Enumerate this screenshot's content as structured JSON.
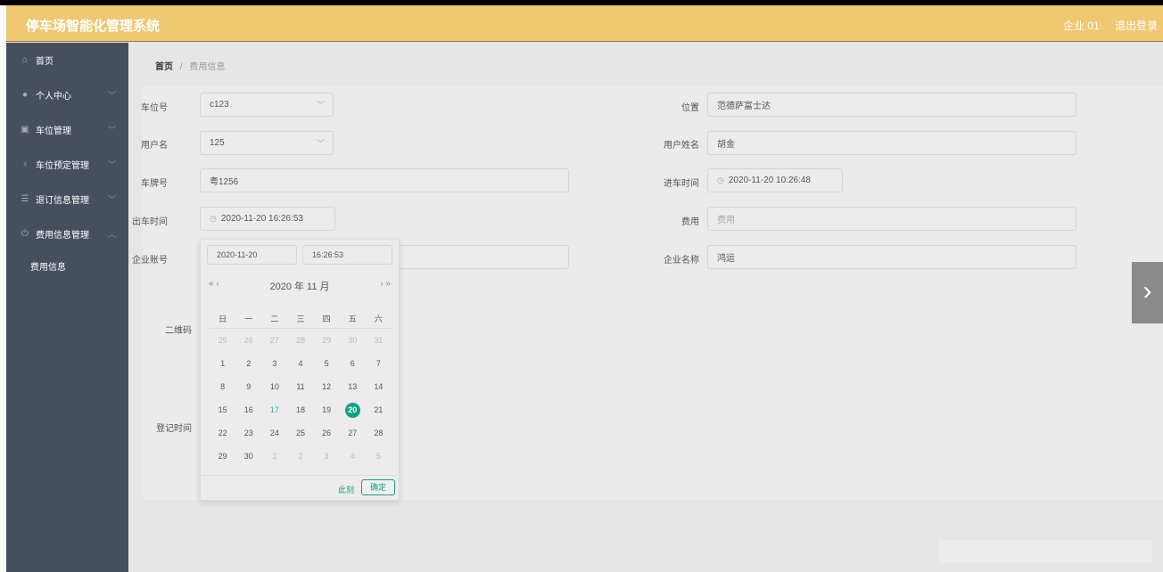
{
  "header": {
    "title": "停车场智能化管理系统",
    "user": "企业 01",
    "logout": "退出登录"
  },
  "sidebar": {
    "items": [
      {
        "label": "首页"
      },
      {
        "label": "个人中心"
      },
      {
        "label": "车位管理"
      },
      {
        "label": "车位预定管理"
      },
      {
        "label": "退订信息管理"
      },
      {
        "label": "费用信息管理"
      }
    ],
    "sub": "费用信息"
  },
  "breadcrumb": {
    "home": "首页",
    "sep": "/",
    "current": "费用信息"
  },
  "form": {
    "spot_label": "车位号",
    "spot": "c123",
    "location_label": "位置",
    "location": "范德萨富士达",
    "username_label": "用户名",
    "username": "125",
    "realname_label": "用户姓名",
    "realname": "胡金",
    "plate_label": "车牌号",
    "plate": "粤1256",
    "in_label": "进车时间",
    "in_time": "2020-11-20 10:26:48",
    "out_label": "出车时间",
    "out_time": "2020-11-20 16:26:53",
    "fee_label": "费用",
    "fee_placeholder": "费用",
    "account_label": "企业账号",
    "company_label": "企业名称",
    "company": "鸿运",
    "qr_label": "二维码",
    "reg_label": "登记时间"
  },
  "picker": {
    "date": "2020-11-20",
    "time": "16:26:53",
    "title": "2020 年  11 月",
    "prev": "« ‹",
    "next": "› »",
    "weekdays": [
      "日",
      "一",
      "二",
      "三",
      "四",
      "五",
      "六"
    ],
    "weeks": [
      [
        "25",
        "26",
        "27",
        "28",
        "29",
        "30",
        "31"
      ],
      [
        "1",
        "2",
        "3",
        "4",
        "5",
        "6",
        "7"
      ],
      [
        "8",
        "9",
        "10",
        "11",
        "12",
        "13",
        "14"
      ],
      [
        "15",
        "16",
        "17",
        "18",
        "19",
        "20",
        "21"
      ],
      [
        "22",
        "23",
        "24",
        "25",
        "26",
        "27",
        "28"
      ],
      [
        "29",
        "30",
        "1",
        "2",
        "3",
        "4",
        "5"
      ]
    ],
    "selected": "20",
    "now": "此刻",
    "confirm": "确定"
  },
  "colors": {
    "header": "#f0c872",
    "sidebar": "#474f5e",
    "accent": "#13a087"
  }
}
